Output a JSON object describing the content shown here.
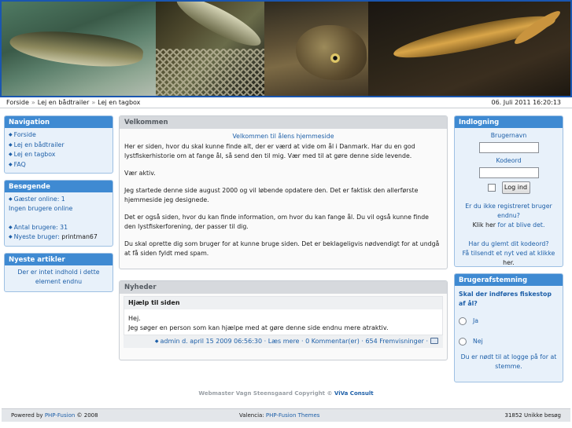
{
  "breadcrumb": {
    "items": [
      "Forside",
      "Lej en bådtrailer",
      "Lej en tagbox"
    ],
    "separator": "»",
    "datetime": "06. Juli 2011 16:20:13"
  },
  "navigation": {
    "title": "Navigation",
    "items": [
      "Forside",
      "Lej en bådtrailer",
      "Lej en tagbox",
      "FAQ"
    ]
  },
  "visitors": {
    "title": "Besøgende",
    "guests_online": "Gæster online: 1",
    "users_online": "Ingen brugere online",
    "user_count": "Antal brugere: 31",
    "newest_user_label": "Nyeste bruger:",
    "newest_user": "printman67"
  },
  "newest_articles": {
    "title": "Nyeste artikler",
    "empty_text": "Der er intet indhold i dette element endnu"
  },
  "welcome": {
    "title": "Velkommen",
    "heading": "Velkommen til ålens hjemmeside",
    "paragraphs": [
      "Her er siden, hvor du skal kunne finde alt, der er værd at vide om ål i Danmark. Har du en god lystfiskerhistorie om at fange ål, så send den til mig.  Vær med til at gøre denne side levende.",
      "Vær aktiv.",
      "Jeg startede denne side august 2000 og vil løbende opdatere den. Det er faktisk den allerførste hjemmeside jeg designede.",
      "Det er også siden, hvor du kan finde information, om hvor du kan fange ål. Du vil også kunne finde den lystfiskerforening, der passer til dig.",
      "Du skal oprette dig som bruger for at kunne bruge siden. Det er beklageligvis nødvendigt for at undgå at få siden fyldt med spam."
    ]
  },
  "news": {
    "title": "Nyheder",
    "item_title": "Hjælp til siden",
    "body_line1": "Hej.",
    "body_line2": "Jeg søger en person som kan hjælpe med at gøre denne side endnu mere atraktiv.",
    "meta": "admin d. april 15 2009 06:56:30 · Læs mere · 0 Kommentar(er) · 654 Fremvisninger ·"
  },
  "login": {
    "title": "Indlogning",
    "username_label": "Brugernavn",
    "password_label": "Kodeord",
    "button": "Log ind",
    "not_registered": "Er du ikke registreret bruger endnu?",
    "click_here": "Klik her",
    "to_register": "for at blive det.",
    "forgot": "Har du glemt dit kodeord?",
    "new_sent": "Få tilsendt et nyt ved at klikke",
    "here": "her."
  },
  "poll": {
    "title": "Brugerafstemning",
    "question": "Skal der indføres fiskestop af ål?",
    "options": [
      "Ja",
      "Nej"
    ],
    "note": "Du er nødt til at logge på for at stemme."
  },
  "copyright": {
    "text": "Webmaster Vagn Steensgaard Copyright ©",
    "link": "ViVa Consult"
  },
  "footer": {
    "powered_by": "Powered by",
    "powered_link": "PHP-Fusion",
    "powered_year": "© 2008",
    "theme_label": "Valencia:",
    "theme_link": "PHP-Fusion Themes",
    "visits": "31852  Unikke besøg"
  }
}
